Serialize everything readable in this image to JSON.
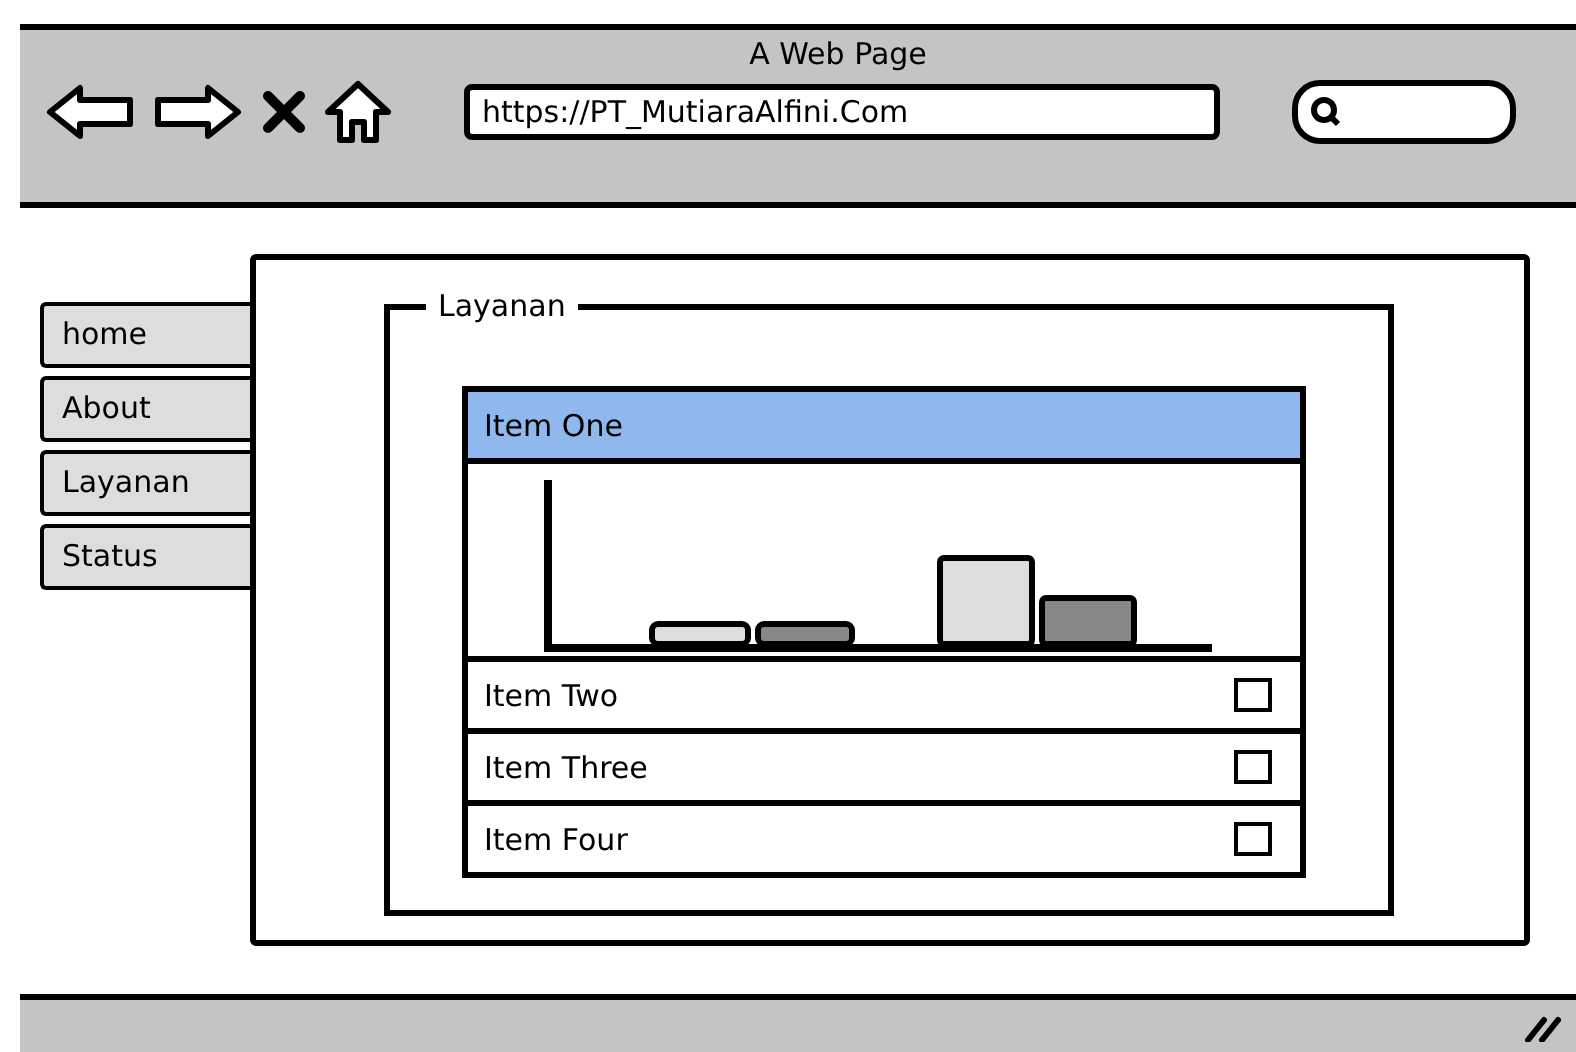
{
  "window": {
    "title": "A Web Page"
  },
  "address_bar": {
    "value": "https://PT_MutiaraAlfini.Com"
  },
  "sidebar": {
    "items": [
      {
        "label": "home"
      },
      {
        "label": "About"
      },
      {
        "label": "Layanan"
      },
      {
        "label": "Status"
      }
    ]
  },
  "group": {
    "title": "Layanan"
  },
  "accordion": {
    "items": [
      {
        "label": "Item One",
        "expanded": true
      },
      {
        "label": "Item Two",
        "expanded": false,
        "checked": false
      },
      {
        "label": "Item Three",
        "expanded": false,
        "checked": false
      },
      {
        "label": "Item Four",
        "expanded": false,
        "checked": false
      }
    ]
  }
}
